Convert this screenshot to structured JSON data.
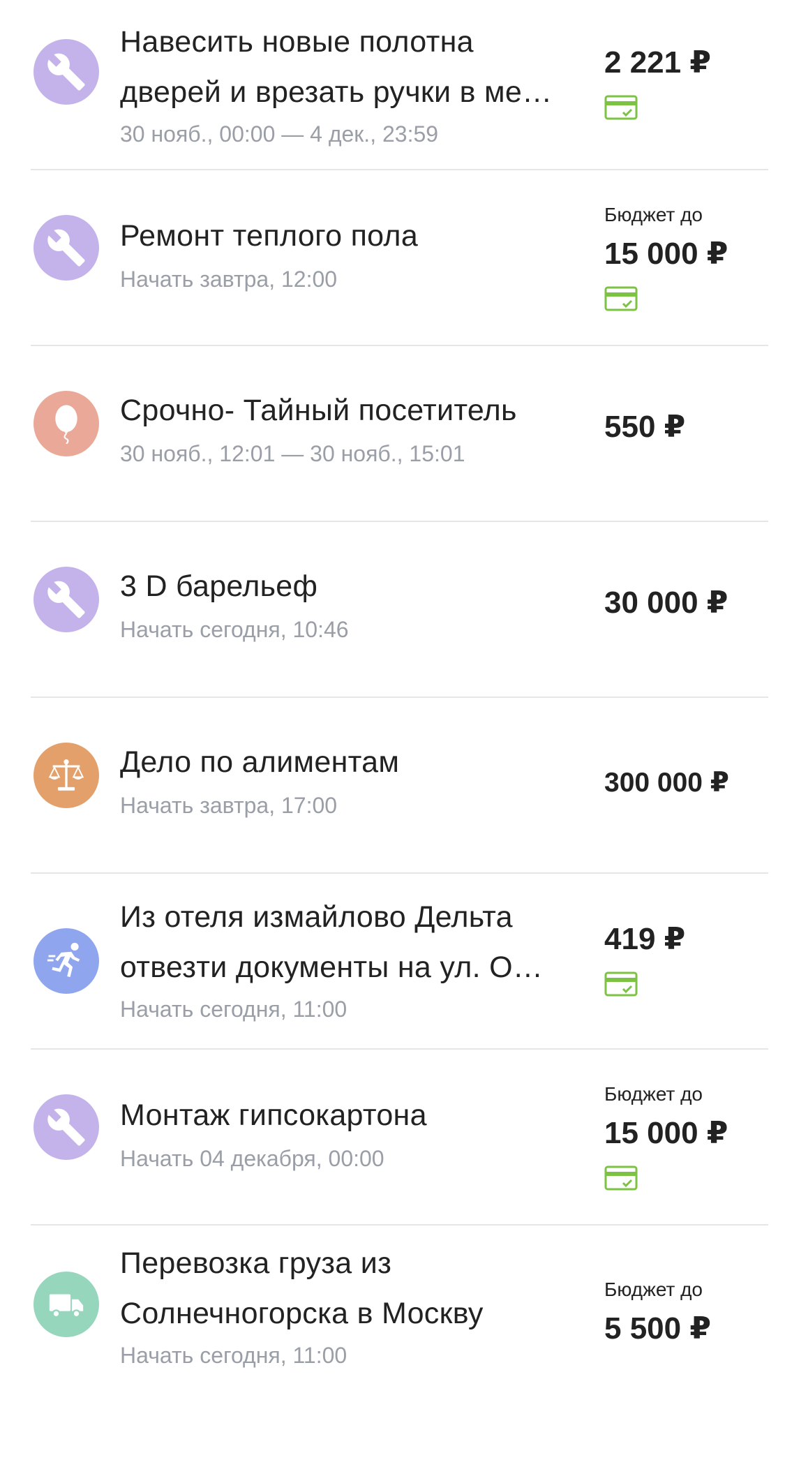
{
  "tasks": [
    {
      "title_lines": [
        "Навесить новые полотна",
        "дверей и врезать ручки в ме…"
      ],
      "meta": "30 нояб., 00:00 — 4 дек., 23:59",
      "budget_label": "",
      "price": "2 221 ₽",
      "card_paid": true,
      "category_icon": "wrench-icon",
      "color": "#c4b3ea"
    },
    {
      "title_lines": [
        "Ремонт теплого пола"
      ],
      "meta": "Начать завтра, 12:00",
      "budget_label": "Бюджет до",
      "price": "15 000 ₽",
      "card_paid": true,
      "category_icon": "wrench-icon",
      "color": "#c4b3ea"
    },
    {
      "title_lines": [
        "Срочно- Тайный посетитель"
      ],
      "meta": "30 нояб., 12:01 — 30 нояб., 15:01",
      "budget_label": "",
      "price": "550 ₽",
      "card_paid": false,
      "category_icon": "balloon-icon",
      "color": "#eaa998"
    },
    {
      "title_lines": [
        "3 D барельеф"
      ],
      "meta": "Начать сегодня, 10:46",
      "budget_label": "",
      "price": "30 000 ₽",
      "card_paid": false,
      "category_icon": "wrench-icon",
      "color": "#c4b3ea"
    },
    {
      "title_lines": [
        "Дело по алиментам"
      ],
      "meta": "Начать завтра, 17:00",
      "budget_label": "",
      "price": "300 000 ₽",
      "card_paid": false,
      "category_icon": "scales-icon",
      "color": "#e4a06a"
    },
    {
      "title_lines": [
        "Из отеля измайлово Дельта",
        "отвезти документы на ул. О…"
      ],
      "meta": "Начать сегодня, 11:00",
      "budget_label": "",
      "price": "419 ₽",
      "card_paid": true,
      "category_icon": "runner-icon",
      "color": "#8fa6ee"
    },
    {
      "title_lines": [
        "Монтаж гипсокартона"
      ],
      "meta": "Начать 04 декабря, 00:00",
      "budget_label": "Бюджет до",
      "price": "15 000 ₽",
      "card_paid": true,
      "category_icon": "wrench-icon",
      "color": "#c4b3ea"
    },
    {
      "title_lines": [
        "Перевозка груза из",
        "Солнечногорска в Москву"
      ],
      "meta": "Начать сегодня, 11:00",
      "budget_label": "Бюджет до",
      "price": "5 500 ₽",
      "card_paid": false,
      "category_icon": "truck-icon",
      "color": "#96d6bd"
    }
  ],
  "colors": {
    "card_icon": "#7cc243",
    "divider": "#e6e6e6",
    "meta_text": "#9a9ea6"
  }
}
